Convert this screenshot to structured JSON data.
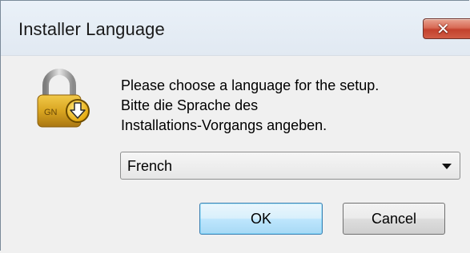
{
  "window": {
    "title": "Installer Language",
    "close_glyph": "✕"
  },
  "dialog": {
    "icon": "padlock-download-icon",
    "message_lines": [
      "Please choose a language for the setup.",
      "Bitte die Sprache des",
      "Installations-Vorgangs angeben."
    ],
    "language_select": {
      "selected": "French"
    },
    "buttons": {
      "ok": "OK",
      "cancel": "Cancel"
    }
  },
  "colors": {
    "close_button": "#c8452f",
    "ok_border": "#3c7fb1",
    "lock_gold": "#d9a520"
  }
}
